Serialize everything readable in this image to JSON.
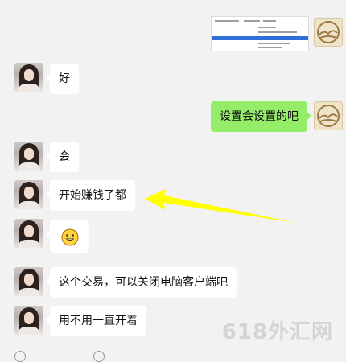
{
  "chat": {
    "messages": [
      {
        "side": "right",
        "type": "image"
      },
      {
        "side": "left",
        "text": "好"
      },
      {
        "side": "right",
        "text": "设置会设置的吧"
      },
      {
        "side": "left",
        "text": "会"
      },
      {
        "side": "left",
        "text": "开始赚钱了都"
      },
      {
        "side": "left",
        "type": "emoji",
        "emoji": "grinning-face"
      },
      {
        "side": "left",
        "text": "这个交易，可以关闭电脑客户端吧"
      },
      {
        "side": "left",
        "text": "用不用一直开着"
      }
    ]
  },
  "watermark": "618外汇网",
  "colors": {
    "bg": "#f2f2f2",
    "bubble_left": "#ffffff",
    "bubble_right": "#95ec69",
    "arrow": "#ffff00"
  },
  "icons": {
    "annotation_arrow": "arrow-pointing-left",
    "avatar_contact": "girl-portrait",
    "avatar_self": "landscape-logo"
  }
}
